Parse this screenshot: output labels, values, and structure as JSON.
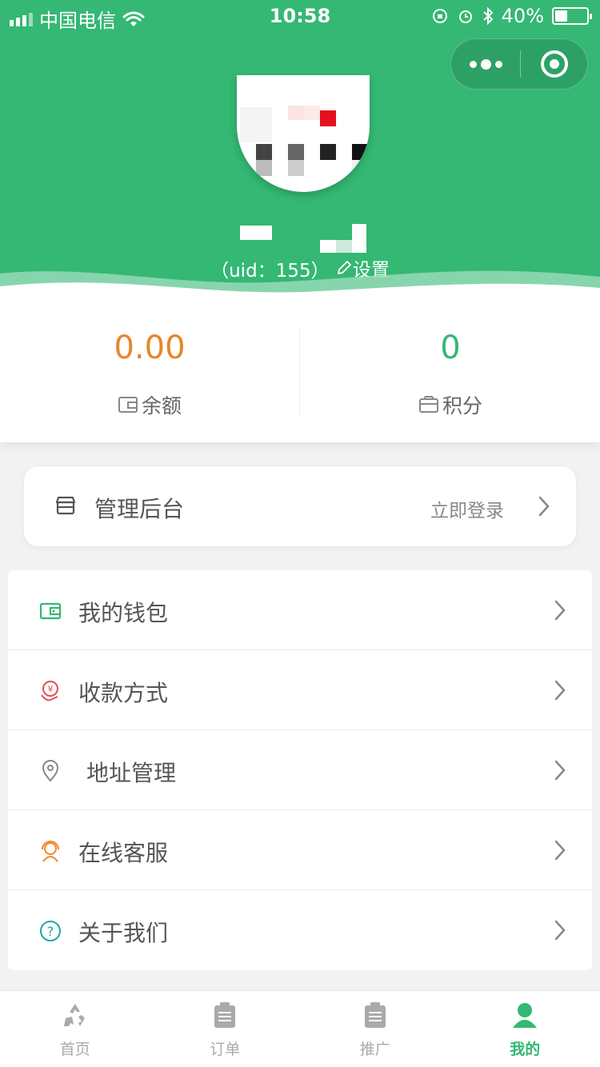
{
  "status_bar": {
    "carrier": "中国电信",
    "time": "10:58",
    "battery_text": "40%",
    "battery_level": 0.4
  },
  "profile": {
    "uid_text": "（uid：155）",
    "settings_label": "设置"
  },
  "stats": {
    "balance": {
      "value": "0.00",
      "label": "余额",
      "color": "#e6862a"
    },
    "points": {
      "value": "0",
      "label": "积分",
      "color": "#34b873"
    }
  },
  "admin": {
    "label": "管理后台",
    "action": "立即登录"
  },
  "menu": {
    "items": [
      {
        "label": "我的钱包",
        "icon": "wallet-icon",
        "color": "#34b873"
      },
      {
        "label": "收款方式",
        "icon": "payment-icon",
        "color": "#e0504f"
      },
      {
        "label": "地址管理",
        "icon": "location-icon",
        "color": "#888888"
      },
      {
        "label": "在线客服",
        "icon": "customer-service-icon",
        "color": "#f08a24"
      },
      {
        "label": "关于我们",
        "icon": "help-icon",
        "color": "#1aaba8"
      }
    ]
  },
  "tabbar": {
    "items": [
      {
        "label": "首页",
        "icon": "recycle-icon",
        "active": false
      },
      {
        "label": "订单",
        "icon": "clipboard-icon",
        "active": false
      },
      {
        "label": "推广",
        "icon": "clipboard-icon",
        "active": false
      },
      {
        "label": "我的",
        "icon": "user-icon",
        "active": true
      }
    ]
  },
  "colors": {
    "brand": "#34b873",
    "orange": "#e6862a",
    "background": "#f2f2f2"
  }
}
